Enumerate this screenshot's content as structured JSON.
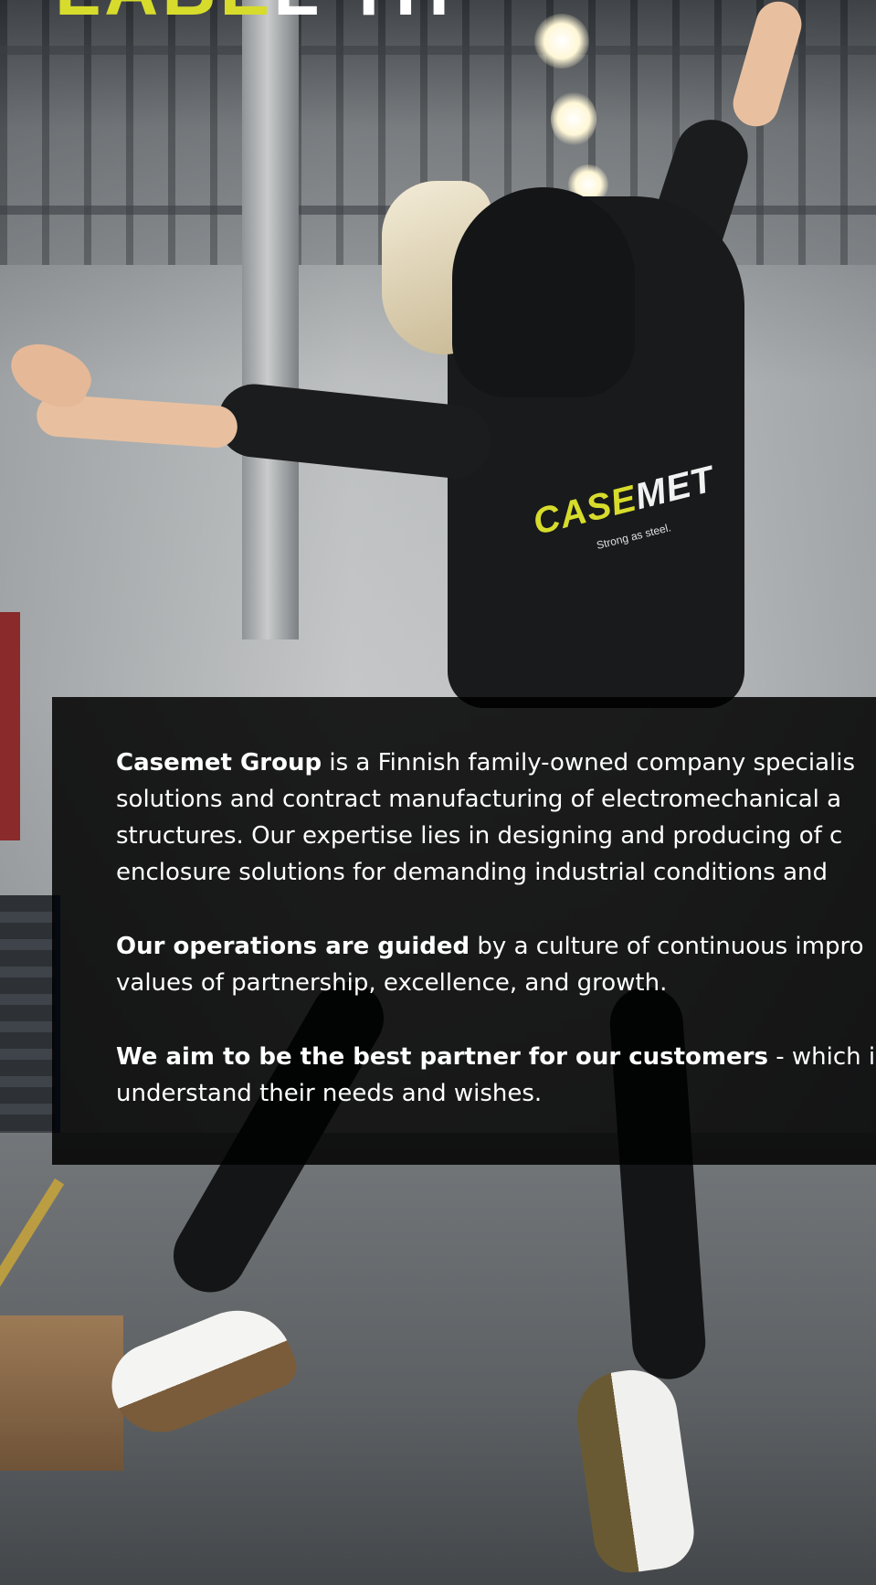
{
  "hero": {
    "headline_accent": "LABE",
    "headline_rest": "L TH",
    "brand_logo": {
      "accent": "CASE",
      "rest": "MET",
      "tagline": "Strong as steel."
    }
  },
  "about": {
    "paragraphs": [
      {
        "bold": "Casemet Group",
        "line1_rest": " is a Finnish family-owned company specialis",
        "line2": "solutions and contract manufacturing of electromechanical a",
        "line3": "structures. Our expertise lies in designing and producing of c",
        "line4": "enclosure solutions for demanding industrial conditions and"
      },
      {
        "bold": "Our operations are guided",
        "line1_rest": " by a culture of continuous impro",
        "line2": "values of partnership, excellence, and growth."
      },
      {
        "bold": "We aim to be the best partner for our customers",
        "line1_rest": " - which is",
        "line2": "understand their needs and wishes."
      }
    ]
  },
  "colors": {
    "brand_accent": "#d7dc2c",
    "panel_background": "#000000",
    "panel_text": "#ffffff"
  }
}
